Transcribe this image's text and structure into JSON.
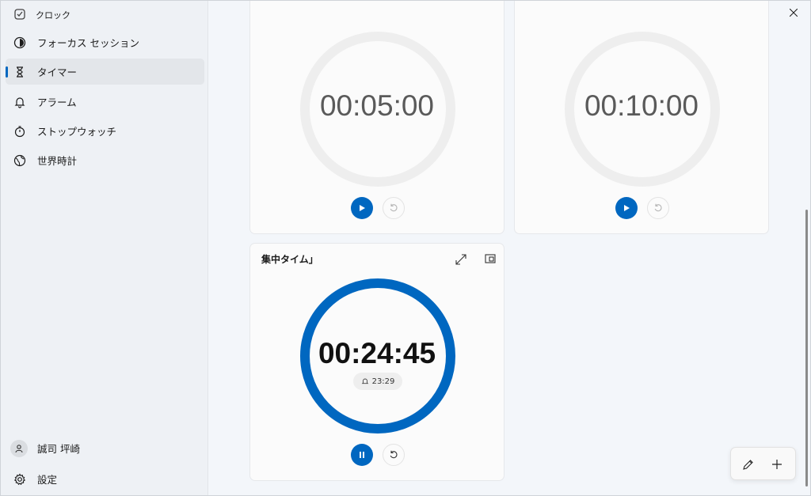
{
  "app": {
    "title": "クロック"
  },
  "sidebar": {
    "items": [
      {
        "label": "フォーカス セッション",
        "icon": "focus-icon"
      },
      {
        "label": "タイマー",
        "icon": "hourglass-icon",
        "active": true
      },
      {
        "label": "アラーム",
        "icon": "bell-icon"
      },
      {
        "label": "ストップウォッチ",
        "icon": "stopwatch-icon"
      },
      {
        "label": "世界時計",
        "icon": "globe-icon"
      }
    ],
    "user": {
      "name": "誠司 坪崎",
      "icon": "person-icon"
    },
    "settings": {
      "label": "設定",
      "icon": "gear-icon"
    }
  },
  "timers": [
    {
      "time": "00:05:00",
      "state": "idle"
    },
    {
      "time": "00:10:00",
      "state": "idle"
    },
    {
      "title": "集中タイム」",
      "time": "00:24:45",
      "alarm_time": "23:29",
      "state": "running",
      "progress": 1.0
    }
  ],
  "colors": {
    "accent": "#0067c0",
    "ring_idle": "#eeeeee",
    "sidebar_bg": "#eef1f5"
  }
}
